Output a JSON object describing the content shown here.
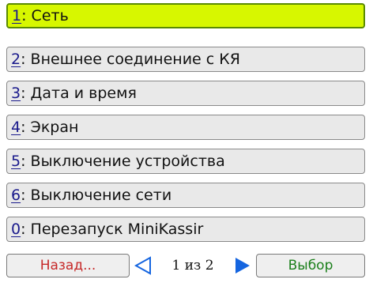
{
  "menu": {
    "items": [
      {
        "key": "1",
        "label": "Сеть",
        "selected": true
      },
      {
        "key": "2",
        "label": "Внешнее соединение с КЯ",
        "selected": false
      },
      {
        "key": "3",
        "label": "Дата и время",
        "selected": false
      },
      {
        "key": "4",
        "label": "Экран",
        "selected": false
      },
      {
        "key": "5",
        "label": "Выключение устройства",
        "selected": false
      },
      {
        "key": "6",
        "label": "Выключение сети",
        "selected": false
      },
      {
        "key": "0",
        "label": "Перезапуск MiniKassir",
        "selected": false
      }
    ],
    "separator": ":"
  },
  "footer": {
    "back_label": "Назад...",
    "select_label": "Выбор",
    "page_text": "1 из 2",
    "prev_icon": "triangle-left-outline-icon",
    "next_icon": "triangle-right-filled-icon"
  },
  "colors": {
    "selected_bg": "#d7f700",
    "item_bg": "#e9e9e9",
    "back_text": "#c62828",
    "select_text": "#1b7f1b",
    "arrow_blue": "#1565e0"
  }
}
